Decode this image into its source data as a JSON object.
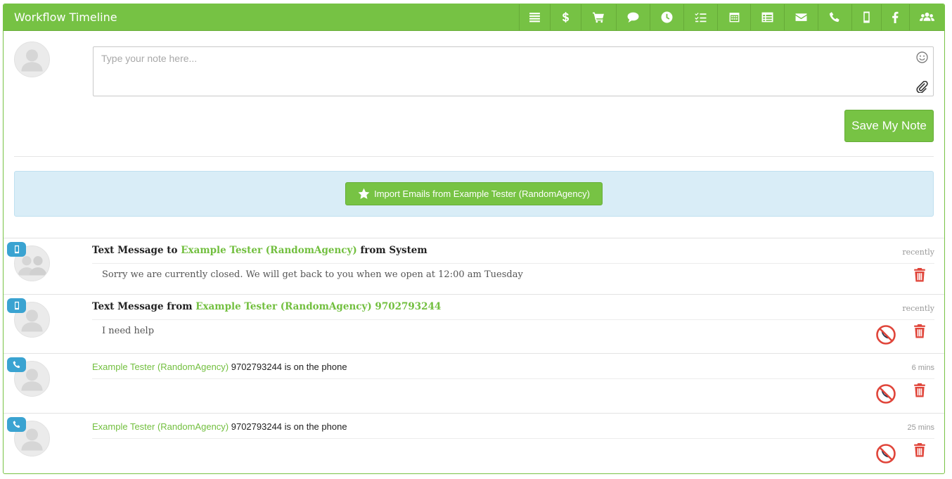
{
  "header": {
    "title": "Workflow Timeline",
    "accent_color": "#76c244",
    "toolbar_icons": [
      "list-icon",
      "dollar-icon",
      "cart-icon",
      "chat-icon",
      "clock-icon",
      "checklist-icon",
      "calendar-icon",
      "table-icon",
      "email-icon",
      "phone-icon",
      "mobile-icon",
      "facebook-icon",
      "group-icon"
    ]
  },
  "composer": {
    "placeholder": "Type your note here...",
    "value": "",
    "save_label": "Save My Note"
  },
  "import": {
    "label": "Import Emails from Example Tester (RandomAgency)",
    "alert_color": "#d9edf7"
  },
  "timeline": [
    {
      "type": "text-message",
      "badge_icon": "mobile-icon",
      "prefix": "Text Message to ",
      "contact": "Example Tester (RandomAgency)",
      "suffix": " from System",
      "time": "recently",
      "body": "Sorry we are currently closed. We will get back to you when we open at 12:00 am Tuesday"
    },
    {
      "type": "text-message",
      "badge_icon": "mobile-icon",
      "prefix": "Text Message from ",
      "contact": "Example Tester (RandomAgency) 9702793244",
      "suffix": "",
      "time": "recently",
      "body": "I need help"
    },
    {
      "type": "call",
      "badge_icon": "phone-icon",
      "contact": "Example Tester (RandomAgency)",
      "suffix": " 9702793244 is on the phone",
      "time": "6 mins"
    },
    {
      "type": "call",
      "badge_icon": "phone-icon",
      "contact": "Example Tester (RandomAgency)",
      "suffix": " 9702793244 is on the phone",
      "time": "25 mins"
    }
  ],
  "colors": {
    "link_green": "#72bf3f",
    "badge_blue": "#3aa3d1",
    "delete_red": "#e0453a"
  }
}
